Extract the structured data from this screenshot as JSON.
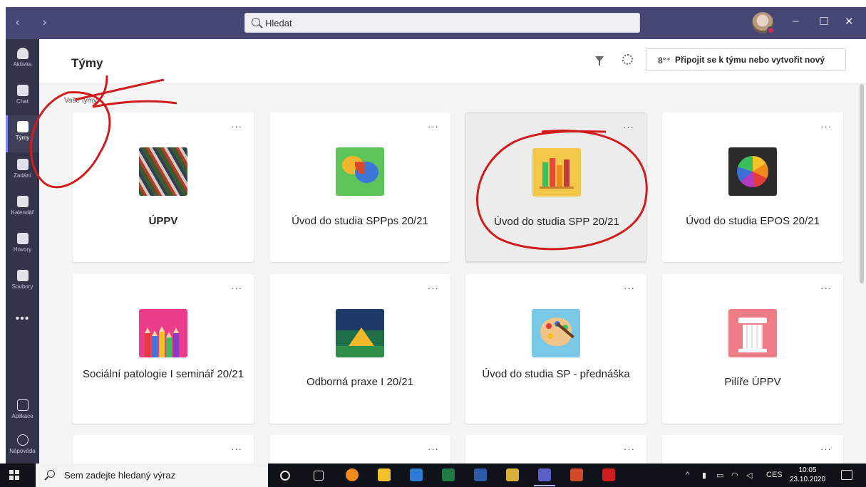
{
  "window": {
    "search_placeholder": "Hledat",
    "nav_arrows": "‹ ›",
    "minimize": "–",
    "maximize": "☐",
    "close": "✕"
  },
  "rail": {
    "items": [
      {
        "label": "Aktivita",
        "icon": "bell-icon"
      },
      {
        "label": "Chat",
        "icon": "chat-icon"
      },
      {
        "label": "Týmy",
        "icon": "teams-icon",
        "active": true
      },
      {
        "label": "Zadání",
        "icon": "assignments-icon"
      },
      {
        "label": "Kalendář",
        "icon": "calendar-icon"
      },
      {
        "label": "Hovory",
        "icon": "phone-icon"
      },
      {
        "label": "Soubory",
        "icon": "file-icon"
      }
    ],
    "more": "•••",
    "apps_label": "Aplikace",
    "help_label": "Nápověda"
  },
  "header": {
    "title": "Týmy",
    "join_button": "Připojit se k týmu nebo vytvořit nový",
    "join_icon": "8°⁺"
  },
  "section": {
    "label": "Vaše týmy"
  },
  "teams": [
    {
      "name": "ÚPPV",
      "tile": "gnomes"
    },
    {
      "name": "Úvod do studia SPPps 20/21",
      "tile": "chat-bubbles"
    },
    {
      "name": "Úvod do studia SPP 20/21",
      "tile": "books"
    },
    {
      "name": "Úvod do studia EPOS 20/21",
      "tile": "color-wheel"
    },
    {
      "name": "Sociální patologie I seminář 20/21",
      "tile": "pencils"
    },
    {
      "name": "Odborná praxe I 20/21",
      "tile": "tent"
    },
    {
      "name": "Úvod do studia SP - přednáška",
      "tile": "palette"
    },
    {
      "name": "Pilíře ÚPPV",
      "tile": "pillar"
    }
  ],
  "card_more": "···",
  "taskbar": {
    "search_placeholder": "Sem zadejte hledaný výraz",
    "lang": "CES",
    "time": "10:05",
    "date": "23.10.2020"
  },
  "colors": {
    "titlebar": "#464775",
    "rail": "#33344a",
    "accent": "#7f85f5",
    "annotation": "#d01c1c"
  }
}
